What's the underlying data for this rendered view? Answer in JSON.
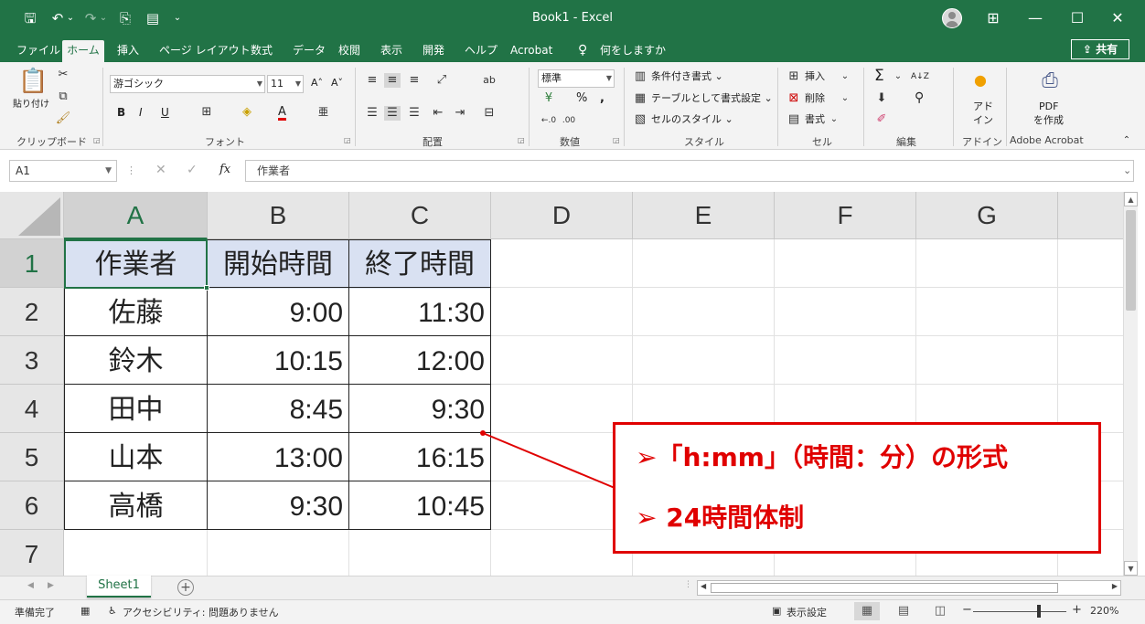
{
  "window": {
    "title": "Book1  -  Excel",
    "minimize": "—",
    "maximize": "☐",
    "close": "✕",
    "ribbon_display": "⊞"
  },
  "quick_access": {
    "save": "🖫",
    "undo": "↶",
    "redo": "↷",
    "touch_mode": "⎘",
    "form": "▤",
    "customize": "⌄"
  },
  "menu": {
    "tabs": [
      "ファイル",
      "ホーム",
      "挿入",
      "ページ レイアウト",
      "数式",
      "データ",
      "校閲",
      "表示",
      "開発",
      "ヘルプ",
      "Acrobat"
    ],
    "active_tab": "ホーム",
    "tell_me": "何をしますか",
    "share": "共有"
  },
  "ribbon": {
    "clipboard": {
      "label": "クリップボード",
      "paste": "貼り付け"
    },
    "font": {
      "label": "フォント",
      "font_name": "游ゴシック",
      "font_size": "11",
      "grow": "A˄",
      "shrink": "A˅",
      "bold": "B",
      "italic": "I",
      "underline": "U",
      "font_color": "A",
      "phonetic": "亜"
    },
    "alignment": {
      "label": "配置"
    },
    "number": {
      "label": "数値",
      "format": "標準",
      "percent": "%",
      "comma": ","
    },
    "styles": {
      "label": "スタイル",
      "conditional": "条件付き書式 ⌄",
      "as_table": "テーブルとして書式設定 ⌄",
      "cell_styles": "セルのスタイル ⌄"
    },
    "cells": {
      "label": "セル",
      "insert": "挿入",
      "delete": "削除",
      "format": "書式"
    },
    "editing": {
      "label": "編集",
      "sum": "Σ",
      "sort": "A↓Z",
      "find": "⚲"
    },
    "addins": {
      "label": "アドイン",
      "button_line1": "アド",
      "button_line2": "イン"
    },
    "acrobat": {
      "label": "Adobe Acrobat",
      "line1": "PDF",
      "line2": "を作成"
    }
  },
  "formula_bar": {
    "name_box": "A1",
    "cancel": "✕",
    "enter": "✓",
    "fx": "fx",
    "content": "作業者"
  },
  "grid": {
    "columns": [
      "A",
      "B",
      "C",
      "D",
      "E",
      "F",
      "G"
    ],
    "rows": [
      "1",
      "2",
      "3",
      "4",
      "5",
      "6",
      "7"
    ],
    "selected_cell": "A1",
    "header_row": [
      "作業者",
      "開始時間",
      "終了時間"
    ],
    "data_rows": [
      [
        "佐藤",
        "9:00",
        "11:30"
      ],
      [
        "鈴木",
        "10:15",
        "12:00"
      ],
      [
        "田中",
        "8:45",
        "9:30"
      ],
      [
        "山本",
        "13:00",
        "16:15"
      ],
      [
        "高橋",
        "9:30",
        "10:45"
      ]
    ],
    "header_fill": "#d9e1f2"
  },
  "callout": {
    "line1": "➢「h:mm」（時間：分）の形式",
    "line2": "➢ 24時間体制",
    "color": "#e00000"
  },
  "sheets": {
    "tabs": [
      "Sheet1"
    ],
    "add": "+"
  },
  "status": {
    "ready": "準備完了",
    "accessibility": "アクセシビリティ: 問題ありません",
    "display_settings": "表示設定",
    "zoom": "220%",
    "zoom_minus": "−",
    "zoom_plus": "+"
  },
  "colors": {
    "excel_green": "#217346",
    "ribbon_bg": "#f3f3f3"
  }
}
